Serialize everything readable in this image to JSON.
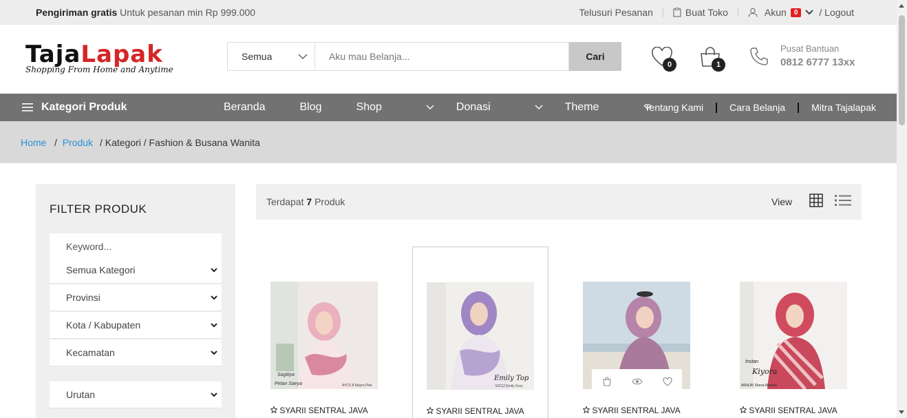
{
  "topbar": {
    "shipping_bold": "Pengiriman gratis",
    "shipping_text": "Untuk pesanan min Rp 999.000",
    "track_orders": "Telusuri Pesanan",
    "open_store": "Buat Toko",
    "account": "Akun",
    "account_badge": "0",
    "logout": "/ Logout"
  },
  "header": {
    "logo_part1": "Taja",
    "logo_part2": "Lapak",
    "tagline": "Shopping From Home and Anytime",
    "search": {
      "category": "Semua",
      "placeholder": "Aku mau Belanja...",
      "button": "Cari"
    },
    "wishlist_count": "0",
    "cart_count": "1",
    "help_label": "Pusat Bantuan",
    "help_phone": "0812 6777 13xx"
  },
  "nav": {
    "categories": "Kategori Produk",
    "menu": [
      "Beranda",
      "Blog",
      "Shop",
      "Donasi",
      "Theme"
    ],
    "right_links": [
      "Tentang Kami",
      "Cara Belanja",
      "Mitra Tajalapak"
    ]
  },
  "breadcrumb": {
    "home": "Home",
    "produk": "Produk",
    "rest": "/ Kategori / Fashion & Busana Wanita"
  },
  "sidebar": {
    "title": "FILTER PRODUK",
    "keyword_placeholder": "Keyword...",
    "filters": [
      "Semua Kategori",
      "Provinsi",
      "Kota / Kabupaten",
      "Kecamatan"
    ],
    "sort": "Urutan"
  },
  "toolbar": {
    "prefix": "Terdapat",
    "count": "7",
    "suffix": "Produk",
    "view_label": "View"
  },
  "products": [
    {
      "seller": "SYARII SENTRAL JAVA",
      "img_caption_top": "Sagitiya",
      "img_caption": "Petan Saeya",
      "img_code": "AYCS 8 Mayra Pink"
    },
    {
      "seller": "SYARII SENTRAL JAVA",
      "img_caption_top": "",
      "img_caption": "Emily Top",
      "img_code": "EIC12 Emily Grey"
    },
    {
      "seller": "SYARII SENTRAL JAVA",
      "img_caption_top": "",
      "img_caption": "",
      "img_code": ""
    },
    {
      "seller": "SYARII SENTRAL JAVA",
      "img_caption_top": "Instan",
      "img_caption": "Kiyora",
      "img_code": "AR9L95 Sheva Maroon"
    }
  ],
  "colors": {
    "brand_red": "#d62525",
    "nav_bg": "#727272",
    "link_blue": "#2a8fd6",
    "badge_red": "#e02020"
  }
}
